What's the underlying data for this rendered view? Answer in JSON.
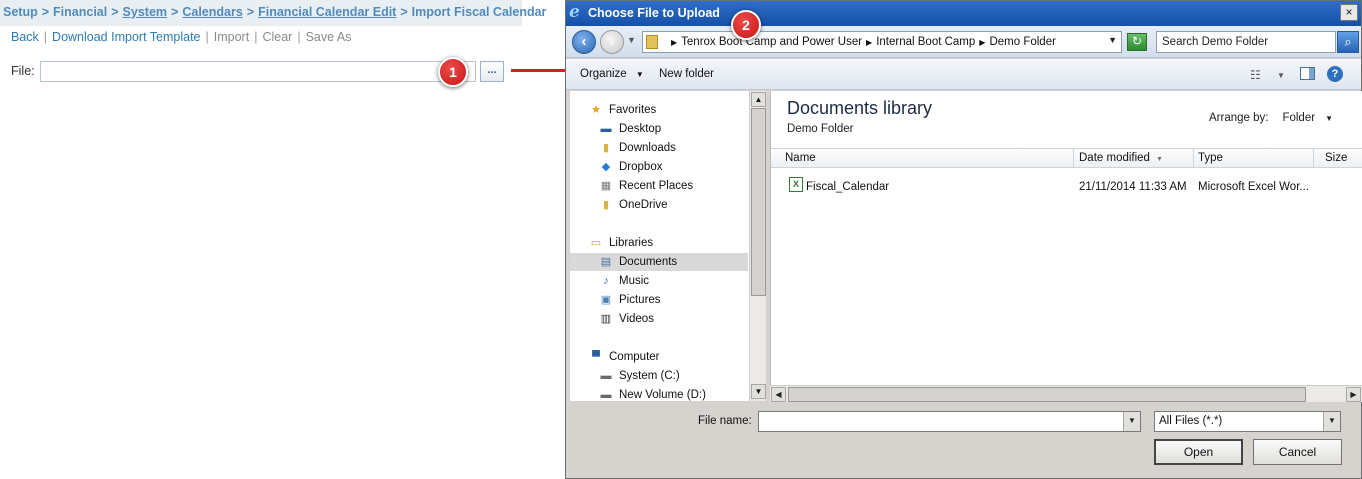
{
  "page": {
    "breadcrumb": [
      {
        "label": "Setup",
        "link": false
      },
      {
        "label": "Financial",
        "link": false
      },
      {
        "label": "System",
        "link": true
      },
      {
        "label": "Calendars",
        "link": true
      },
      {
        "label": "Financial Calendar Edit",
        "link": true
      },
      {
        "label": "Import Fiscal Calendar",
        "link": false
      }
    ],
    "breadcrumb_sep": ">",
    "toolbar": {
      "back": "Back",
      "download": "Download Import Template",
      "import": "Import",
      "clear": "Clear",
      "save_as": "Save As",
      "sep": "|"
    },
    "file_label": "File:",
    "file_value": "",
    "browse_label": "..."
  },
  "callouts": {
    "one": "1",
    "two": "2"
  },
  "dialog": {
    "title": "Choose File to Upload",
    "close": "×",
    "ie_glyph": "e",
    "address": {
      "segments": [
        "Tenrox Boot Camp and Power User",
        "Internal Boot Camp",
        "Demo Folder"
      ]
    },
    "search_placeholder": "Search Demo Folder",
    "commands": {
      "organize": "Organize",
      "new_folder": "New folder"
    },
    "nav": [
      {
        "label": "Favorites",
        "icon": "star-icon",
        "glyph": "★",
        "color": "#e8a317",
        "level": 0
      },
      {
        "label": "Desktop",
        "icon": "desktop-icon",
        "glyph": "▬",
        "color": "#2b5e9e",
        "level": 1
      },
      {
        "label": "Downloads",
        "icon": "downloads-icon",
        "glyph": "▮",
        "color": "#d9b24a",
        "level": 1
      },
      {
        "label": "Dropbox",
        "icon": "dropbox-icon",
        "glyph": "◆",
        "color": "#1e7fd8",
        "level": 1
      },
      {
        "label": "Recent Places",
        "icon": "recent-places-icon",
        "glyph": "▦",
        "color": "#777777",
        "level": 1
      },
      {
        "label": "OneDrive",
        "icon": "onedrive-folder-icon",
        "glyph": "▮",
        "color": "#d9b24a",
        "level": 1
      },
      {
        "label": "Libraries",
        "icon": "libraries-icon",
        "glyph": "▭",
        "color": "#c9a23a",
        "level": 0
      },
      {
        "label": "Documents",
        "icon": "documents-icon",
        "glyph": "▤",
        "color": "#4a6fa0",
        "level": 1,
        "selected": true
      },
      {
        "label": "Music",
        "icon": "music-icon",
        "glyph": "♪",
        "color": "#2b6bb8",
        "level": 1
      },
      {
        "label": "Pictures",
        "icon": "pictures-icon",
        "glyph": "▣",
        "color": "#4a7fb8",
        "level": 1
      },
      {
        "label": "Videos",
        "icon": "videos-icon",
        "glyph": "▥",
        "color": "#333333",
        "level": 1
      },
      {
        "label": "Computer",
        "icon": "computer-icon",
        "glyph": "▀",
        "color": "#2b5e9e",
        "level": 0
      },
      {
        "label": "System (C:)",
        "icon": "drive-c-icon",
        "glyph": "▬",
        "color": "#6b6b6b",
        "level": 1
      },
      {
        "label": "New Volume (D:)",
        "icon": "drive-d-icon",
        "glyph": "▬",
        "color": "#6b6b6b",
        "level": 1
      }
    ],
    "library": {
      "title": "Documents library",
      "subtitle": "Demo Folder"
    },
    "arrange": {
      "label": "Arrange by:",
      "value": "Folder"
    },
    "columns": {
      "name": "Name",
      "date": "Date modified",
      "type": "Type",
      "size": "Size"
    },
    "files": [
      {
        "name": "Fiscal_Calendar",
        "date": "21/11/2014 11:33 AM",
        "type": "Microsoft Excel Wor...",
        "icon": "excel-file-icon"
      }
    ],
    "filename_label": "File name:",
    "filename_value": "",
    "filetype": "All Files (*.*)",
    "open": "Open",
    "cancel": "Cancel"
  },
  "colors": {
    "accent": "#2e7bb5",
    "breadcrumb": "#4f8bbd",
    "callout": "#d42222",
    "arrow": "#e01b1b",
    "titlebar": "#1f5fb8"
  }
}
